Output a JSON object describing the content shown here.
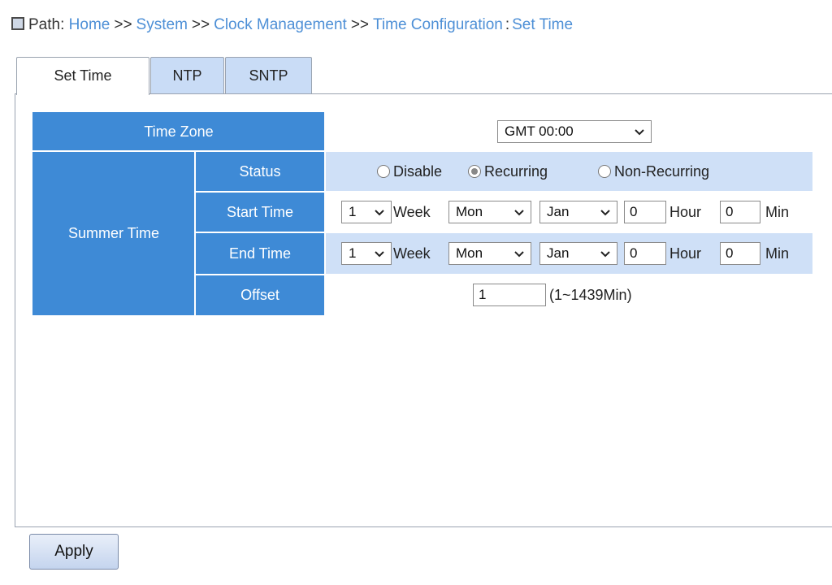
{
  "path": {
    "label": "Path:",
    "crumbs": [
      "Home",
      "System",
      "Clock Management",
      "Time Configuration"
    ],
    "separator": ">>",
    "current": "Set Time"
  },
  "tabs": [
    {
      "label": "Set Time",
      "active": true
    },
    {
      "label": "NTP",
      "active": false
    },
    {
      "label": "SNTP",
      "active": false
    }
  ],
  "form": {
    "time_zone": {
      "label": "Time Zone",
      "value": "GMT 00:00"
    },
    "summer_time": {
      "label": "Summer Time",
      "status": {
        "label": "Status",
        "options": [
          "Disable",
          "Recurring",
          "Non-Recurring"
        ],
        "selected": "Recurring"
      },
      "start_time": {
        "label": "Start Time",
        "week": "1",
        "week_unit": "Week",
        "day": "Mon",
        "month": "Jan",
        "hour": "0",
        "hour_unit": "Hour",
        "min": "0",
        "min_unit": "Min"
      },
      "end_time": {
        "label": "End Time",
        "week": "1",
        "week_unit": "Week",
        "day": "Mon",
        "month": "Jan",
        "hour": "0",
        "hour_unit": "Hour",
        "min": "0",
        "min_unit": "Min"
      },
      "offset": {
        "label": "Offset",
        "value": "1",
        "range": "(1~1439Min)"
      }
    }
  },
  "actions": {
    "apply_label": "Apply"
  },
  "colors": {
    "header_blue": "#3e8ad6",
    "row_pale": "#cfe0f7",
    "link": "#4d8fd6",
    "tab_bg": "#c9dcf6"
  },
  "icons": {
    "path": "square-icon",
    "dropdown": "chevron-down-icon"
  }
}
